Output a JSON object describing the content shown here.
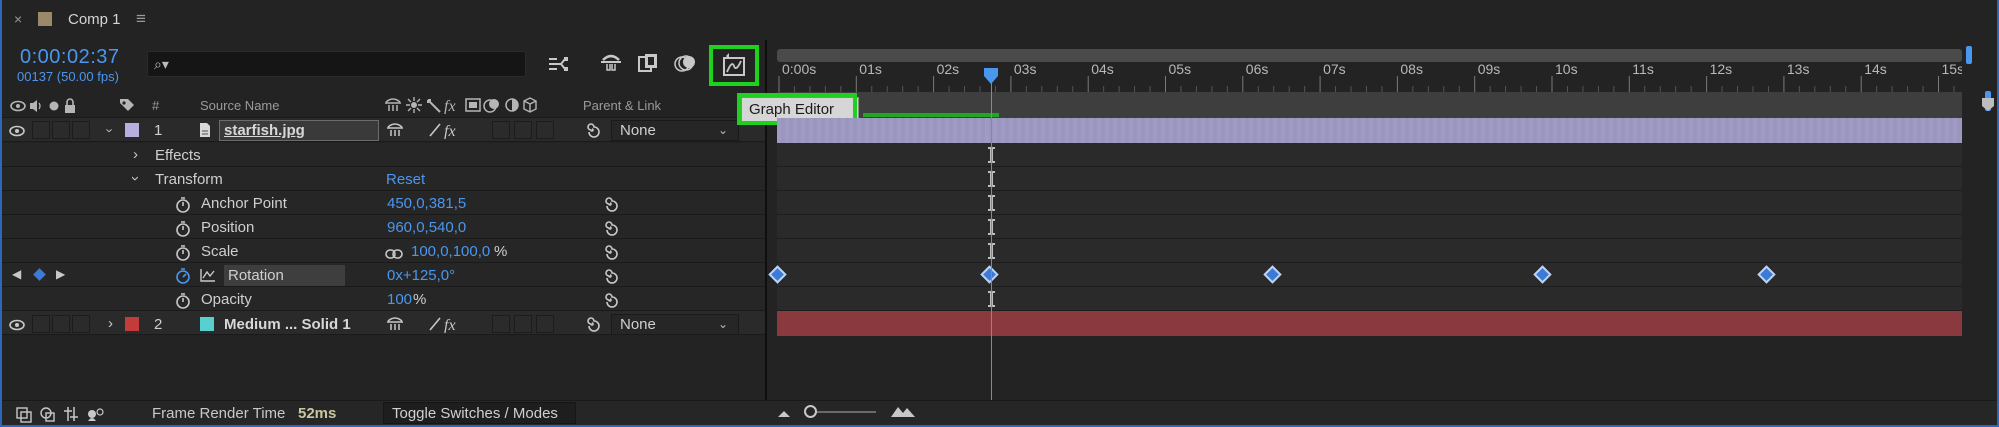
{
  "tab": {
    "close_glyph": "×",
    "title": "Comp 1",
    "menu_glyph": "≡",
    "swatch_color": "#9a8a6a"
  },
  "comp": {
    "timecode": "0:00:02:37",
    "frame_info": "00137 (50.00 fps)",
    "search_glyph": "⌕▾"
  },
  "toolbar_icons": [
    "draft-3d-icon",
    "hide-shy-icon",
    "frame-blending-icon",
    "motion-blur-icon",
    "graph-editor-icon"
  ],
  "columns": {
    "hash": "#",
    "source_name": "Source Name",
    "parent_link": "Parent & Link"
  },
  "layers": [
    {
      "num": "1",
      "name": "starfish.jpg",
      "label_color": "#b6b0e0",
      "parent": "None"
    },
    {
      "num": "2",
      "name": "Medium ... Solid 1",
      "label_color": "#c43b3b",
      "swatch": "#58d0d0",
      "parent": "None"
    }
  ],
  "props": {
    "effects": "Effects",
    "transform": "Transform",
    "reset": "Reset",
    "anchor_label": "Anchor Point",
    "anchor_val": "450,0,381,5",
    "position_label": "Position",
    "position_val": "960,0,540,0",
    "scale_label": "Scale",
    "scale_val": "100,0,100,0",
    "scale_unit": "%",
    "rotation_label": "Rotation",
    "rotation_val": "0x+125,0°",
    "opacity_label": "Opacity",
    "opacity_val": "100",
    "opacity_unit": "%"
  },
  "ruler": {
    "ticks": [
      "0:00s",
      "01s",
      "02s",
      "03s",
      "04s",
      "05s",
      "06s",
      "07s",
      "08s",
      "09s",
      "10s",
      "11s",
      "12s",
      "13s",
      "14s",
      "15s"
    ],
    "playhead_seconds": 2.74
  },
  "tooltip": "Graph Editor",
  "keyframes_seconds": [
    0,
    2.74,
    6.4,
    9.9,
    12.8
  ],
  "bottom": {
    "frame_render_label": "Frame Render Time",
    "frame_render_value": "52ms",
    "toggle_label": "Toggle Switches / Modes"
  },
  "colors": {
    "accent": "#4a97f0",
    "highlight": "#1fd01f",
    "layer1_bar": "#9a96c0",
    "layer2_bar": "#8a3a3e"
  }
}
